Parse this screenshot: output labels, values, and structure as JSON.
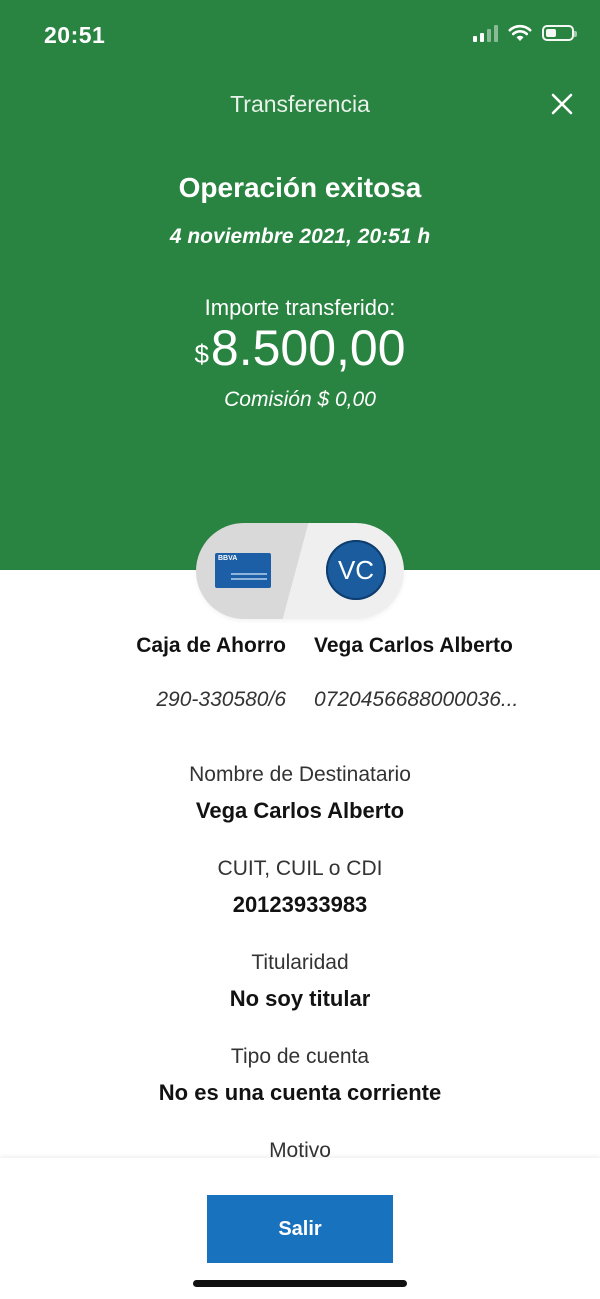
{
  "status_bar": {
    "time": "20:51"
  },
  "header": {
    "nav_title": "Transferencia",
    "result_title": "Operación exitosa",
    "date": "4 noviembre 2021, 20:51 h",
    "amount_label": "Importe transferido:",
    "amount_currency": "$",
    "amount": "8.500,00",
    "commission": "Comisión  $ 0,00"
  },
  "transfer": {
    "card_brand": "BBVA",
    "avatar_initials": "VC",
    "from_account_name": "Caja de Ahorro",
    "from_account_number": "290-330580/6",
    "to_account_name": "Vega Carlos Alberto",
    "to_account_number": "0720456688000036..."
  },
  "details": [
    {
      "label": "Nombre de Destinatario",
      "value": "Vega Carlos Alberto"
    },
    {
      "label": "CUIT, CUIL o CDI",
      "value": "20123933983"
    },
    {
      "label": "Titularidad",
      "value": "No soy titular"
    },
    {
      "label": "Tipo de cuenta",
      "value": "No es una cuenta corriente"
    },
    {
      "label": "Motivo",
      "value": ""
    }
  ],
  "footer": {
    "exit_label": "Salir"
  },
  "colors": {
    "header_green": "#2a8441",
    "button_blue": "#1872bd",
    "avatar_blue": "#1a5c9e"
  },
  "icons": [
    "signal-icon",
    "wifi-icon",
    "battery-icon",
    "close-icon",
    "bank-card-icon"
  ]
}
